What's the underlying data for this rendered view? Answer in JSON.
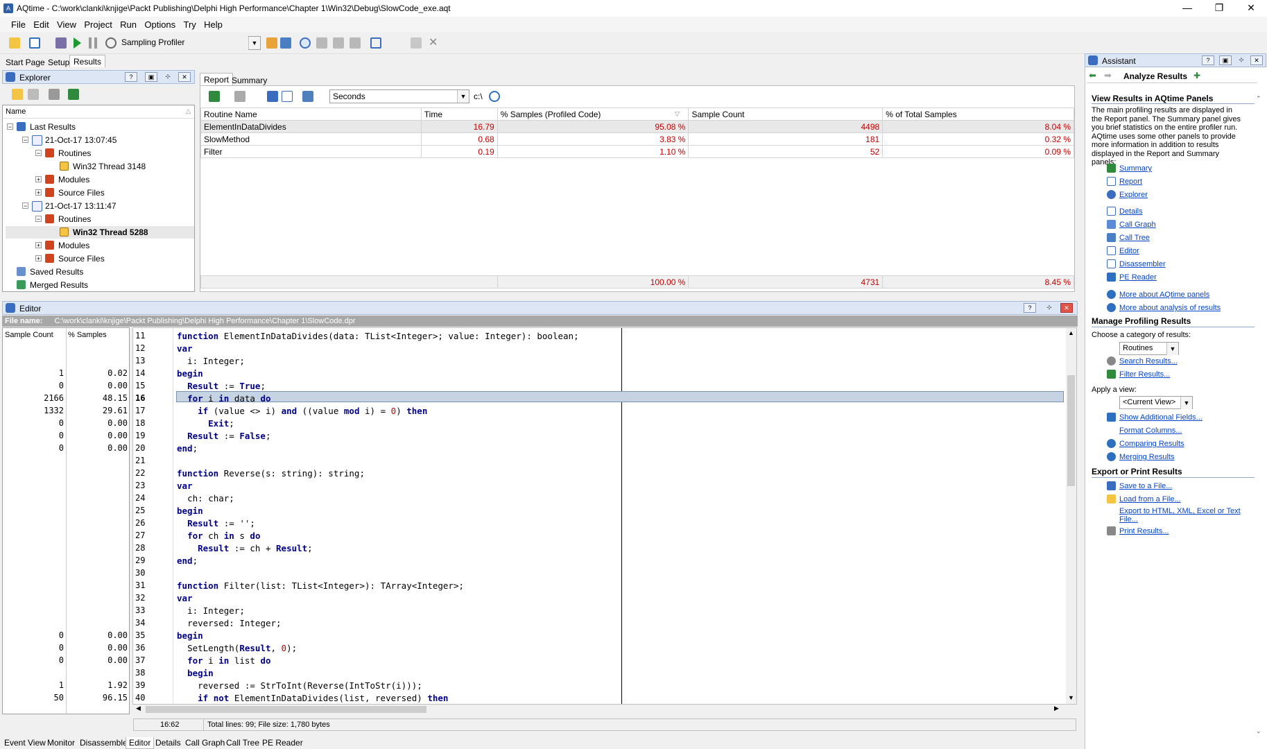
{
  "window": {
    "title": "AQtime - C:\\work\\clanki\\knjige\\Packt Publishing\\Delphi High Performance\\Chapter 1\\Win32\\Debug\\SlowCode_exe.aqt"
  },
  "menu": [
    "File",
    "Edit",
    "View",
    "Project",
    "Run",
    "Options",
    "Try",
    "Help"
  ],
  "toolbar": {
    "profiler": "Sampling Profiler"
  },
  "main_tabs": [
    "Start Page",
    "Setup",
    "Results"
  ],
  "explorer": {
    "title": "Explorer",
    "column": "Name",
    "tree": [
      {
        "label": "Last Results"
      },
      {
        "label": "21-Oct-17 13:07:45"
      },
      {
        "label": "Routines"
      },
      {
        "label": "Win32 Thread 3148"
      },
      {
        "label": "Modules"
      },
      {
        "label": "Source Files"
      },
      {
        "label": "21-Oct-17 13:11:47"
      },
      {
        "label": "Routines"
      },
      {
        "label": "Win32 Thread 5288"
      },
      {
        "label": "Modules"
      },
      {
        "label": "Source Files"
      },
      {
        "label": "Saved Results"
      },
      {
        "label": "Merged Results"
      }
    ]
  },
  "report": {
    "tabs": [
      "Report",
      "Summary"
    ],
    "units": "Seconds",
    "path_btn": "c:\\",
    "columns": [
      "Routine Name",
      "Time",
      "% Samples (Profiled Code)",
      "Sample Count",
      "% of Total Samples"
    ],
    "rows": [
      [
        "ElementInDataDivides",
        "16.79",
        "95.08 %",
        "4498",
        "8.04 %"
      ],
      [
        "SlowMethod",
        "0.68",
        "3.83 %",
        "181",
        "0.32 %"
      ],
      [
        "Filter",
        "0.19",
        "1.10 %",
        "52",
        "0.09 %"
      ]
    ],
    "footer": [
      "",
      "",
      "100.00 %",
      "4731",
      "8.45 %"
    ]
  },
  "editor": {
    "title": "Editor",
    "file_label": "File name:",
    "file_path": "C:\\work\\clanki\\knjige\\Packt Publishing\\Delphi High Performance\\Chapter 1\\SlowCode.dpr",
    "col_count": "Sample Count",
    "col_pct": "% Samples",
    "lines": [
      {
        "n": "11",
        "sc": "",
        "ps": "",
        "code": "function ElementInDataDivides(data: TList<Integer>; value: Integer): boolean;"
      },
      {
        "n": "12",
        "sc": "",
        "ps": "",
        "code": "var"
      },
      {
        "n": "13",
        "sc": "",
        "ps": "",
        "code": "  i: Integer;"
      },
      {
        "n": "14",
        "sc": "1",
        "ps": "0.02",
        "code": "begin"
      },
      {
        "n": "15",
        "sc": "0",
        "ps": "0.00",
        "code": "  Result := True;"
      },
      {
        "n": "16",
        "sc": "2166",
        "ps": "48.15",
        "code": "  for i in data do"
      },
      {
        "n": "17",
        "sc": "1332",
        "ps": "29.61",
        "code": "    if (value <> i) and ((value mod i) = 0) then"
      },
      {
        "n": "18",
        "sc": "0",
        "ps": "0.00",
        "code": "      Exit;"
      },
      {
        "n": "19",
        "sc": "0",
        "ps": "0.00",
        "code": "  Result := False;"
      },
      {
        "n": "20",
        "sc": "0",
        "ps": "0.00",
        "code": "end;"
      },
      {
        "n": "21",
        "sc": "",
        "ps": "",
        "code": ""
      },
      {
        "n": "22",
        "sc": "",
        "ps": "",
        "code": "function Reverse(s: string): string;"
      },
      {
        "n": "23",
        "sc": "",
        "ps": "",
        "code": "var"
      },
      {
        "n": "24",
        "sc": "",
        "ps": "",
        "code": "  ch: char;"
      },
      {
        "n": "25",
        "sc": "",
        "ps": "",
        "code": "begin"
      },
      {
        "n": "26",
        "sc": "",
        "ps": "",
        "code": "  Result := '';"
      },
      {
        "n": "27",
        "sc": "",
        "ps": "",
        "code": "  for ch in s do"
      },
      {
        "n": "28",
        "sc": "",
        "ps": "",
        "code": "    Result := ch + Result;"
      },
      {
        "n": "29",
        "sc": "",
        "ps": "",
        "code": "end;"
      },
      {
        "n": "30",
        "sc": "",
        "ps": "",
        "code": ""
      },
      {
        "n": "31",
        "sc": "",
        "ps": "",
        "code": "function Filter(list: TList<Integer>): TArray<Integer>;"
      },
      {
        "n": "32",
        "sc": "",
        "ps": "",
        "code": "var"
      },
      {
        "n": "33",
        "sc": "",
        "ps": "",
        "code": "  i: Integer;"
      },
      {
        "n": "34",
        "sc": "",
        "ps": "",
        "code": "  reversed: Integer;"
      },
      {
        "n": "35",
        "sc": "0",
        "ps": "0.00",
        "code": "begin"
      },
      {
        "n": "36",
        "sc": "0",
        "ps": "0.00",
        "code": "  SetLength(Result, 0);"
      },
      {
        "n": "37",
        "sc": "0",
        "ps": "0.00",
        "code": "  for i in list do"
      },
      {
        "n": "38",
        "sc": "",
        "ps": "",
        "code": "  begin"
      },
      {
        "n": "39",
        "sc": "1",
        "ps": "1.92",
        "code": "    reversed := StrToInt(Reverse(IntToStr(i)));"
      },
      {
        "n": "40",
        "sc": "50",
        "ps": "96.15",
        "code": "    if not ElementInDataDivides(list, reversed) then"
      }
    ],
    "status_pos": "16:62",
    "status_info": "Total lines: 99; File size: 1,780 bytes"
  },
  "bottom_tabs": [
    "Event View",
    "Monitor",
    "Disassembler",
    "Editor",
    "Details",
    "Call Graph",
    "Call Tree",
    "PE Reader"
  ],
  "assistant": {
    "title": "Assistant",
    "heading": "Analyze Results",
    "sec1": "View Results in AQtime Panels",
    "sec1_text": "The main profiling results are displayed in the Report panel. The Summary panel gives you brief statistics on the entire profiler run. AQtime uses some other panels to provide more information in addition to results displayed in the Report and Summary panels:",
    "links1": [
      "Summary",
      "Report",
      "Explorer"
    ],
    "links2": [
      "Details",
      "Call Graph",
      "Call Tree",
      "Editor",
      "Disassembler",
      "PE Reader"
    ],
    "links3": [
      "More about AQtime panels",
      "More about analysis of results"
    ],
    "sec2": "Manage Profiling Results",
    "choose": "Choose a category of results:",
    "category": "Routines",
    "links4": [
      "Search Results...",
      "Filter Results..."
    ],
    "apply": "Apply a view:",
    "view": "<Current View>",
    "links5": [
      "Show Additional Fields...",
      "Format Columns...",
      "Comparing Results",
      "Merging Results"
    ],
    "sec3": "Export or Print Results",
    "links6": [
      "Save to a File...",
      "Load from a File...",
      "Export to HTML, XML, Excel or Text File...",
      "Print Results..."
    ]
  }
}
